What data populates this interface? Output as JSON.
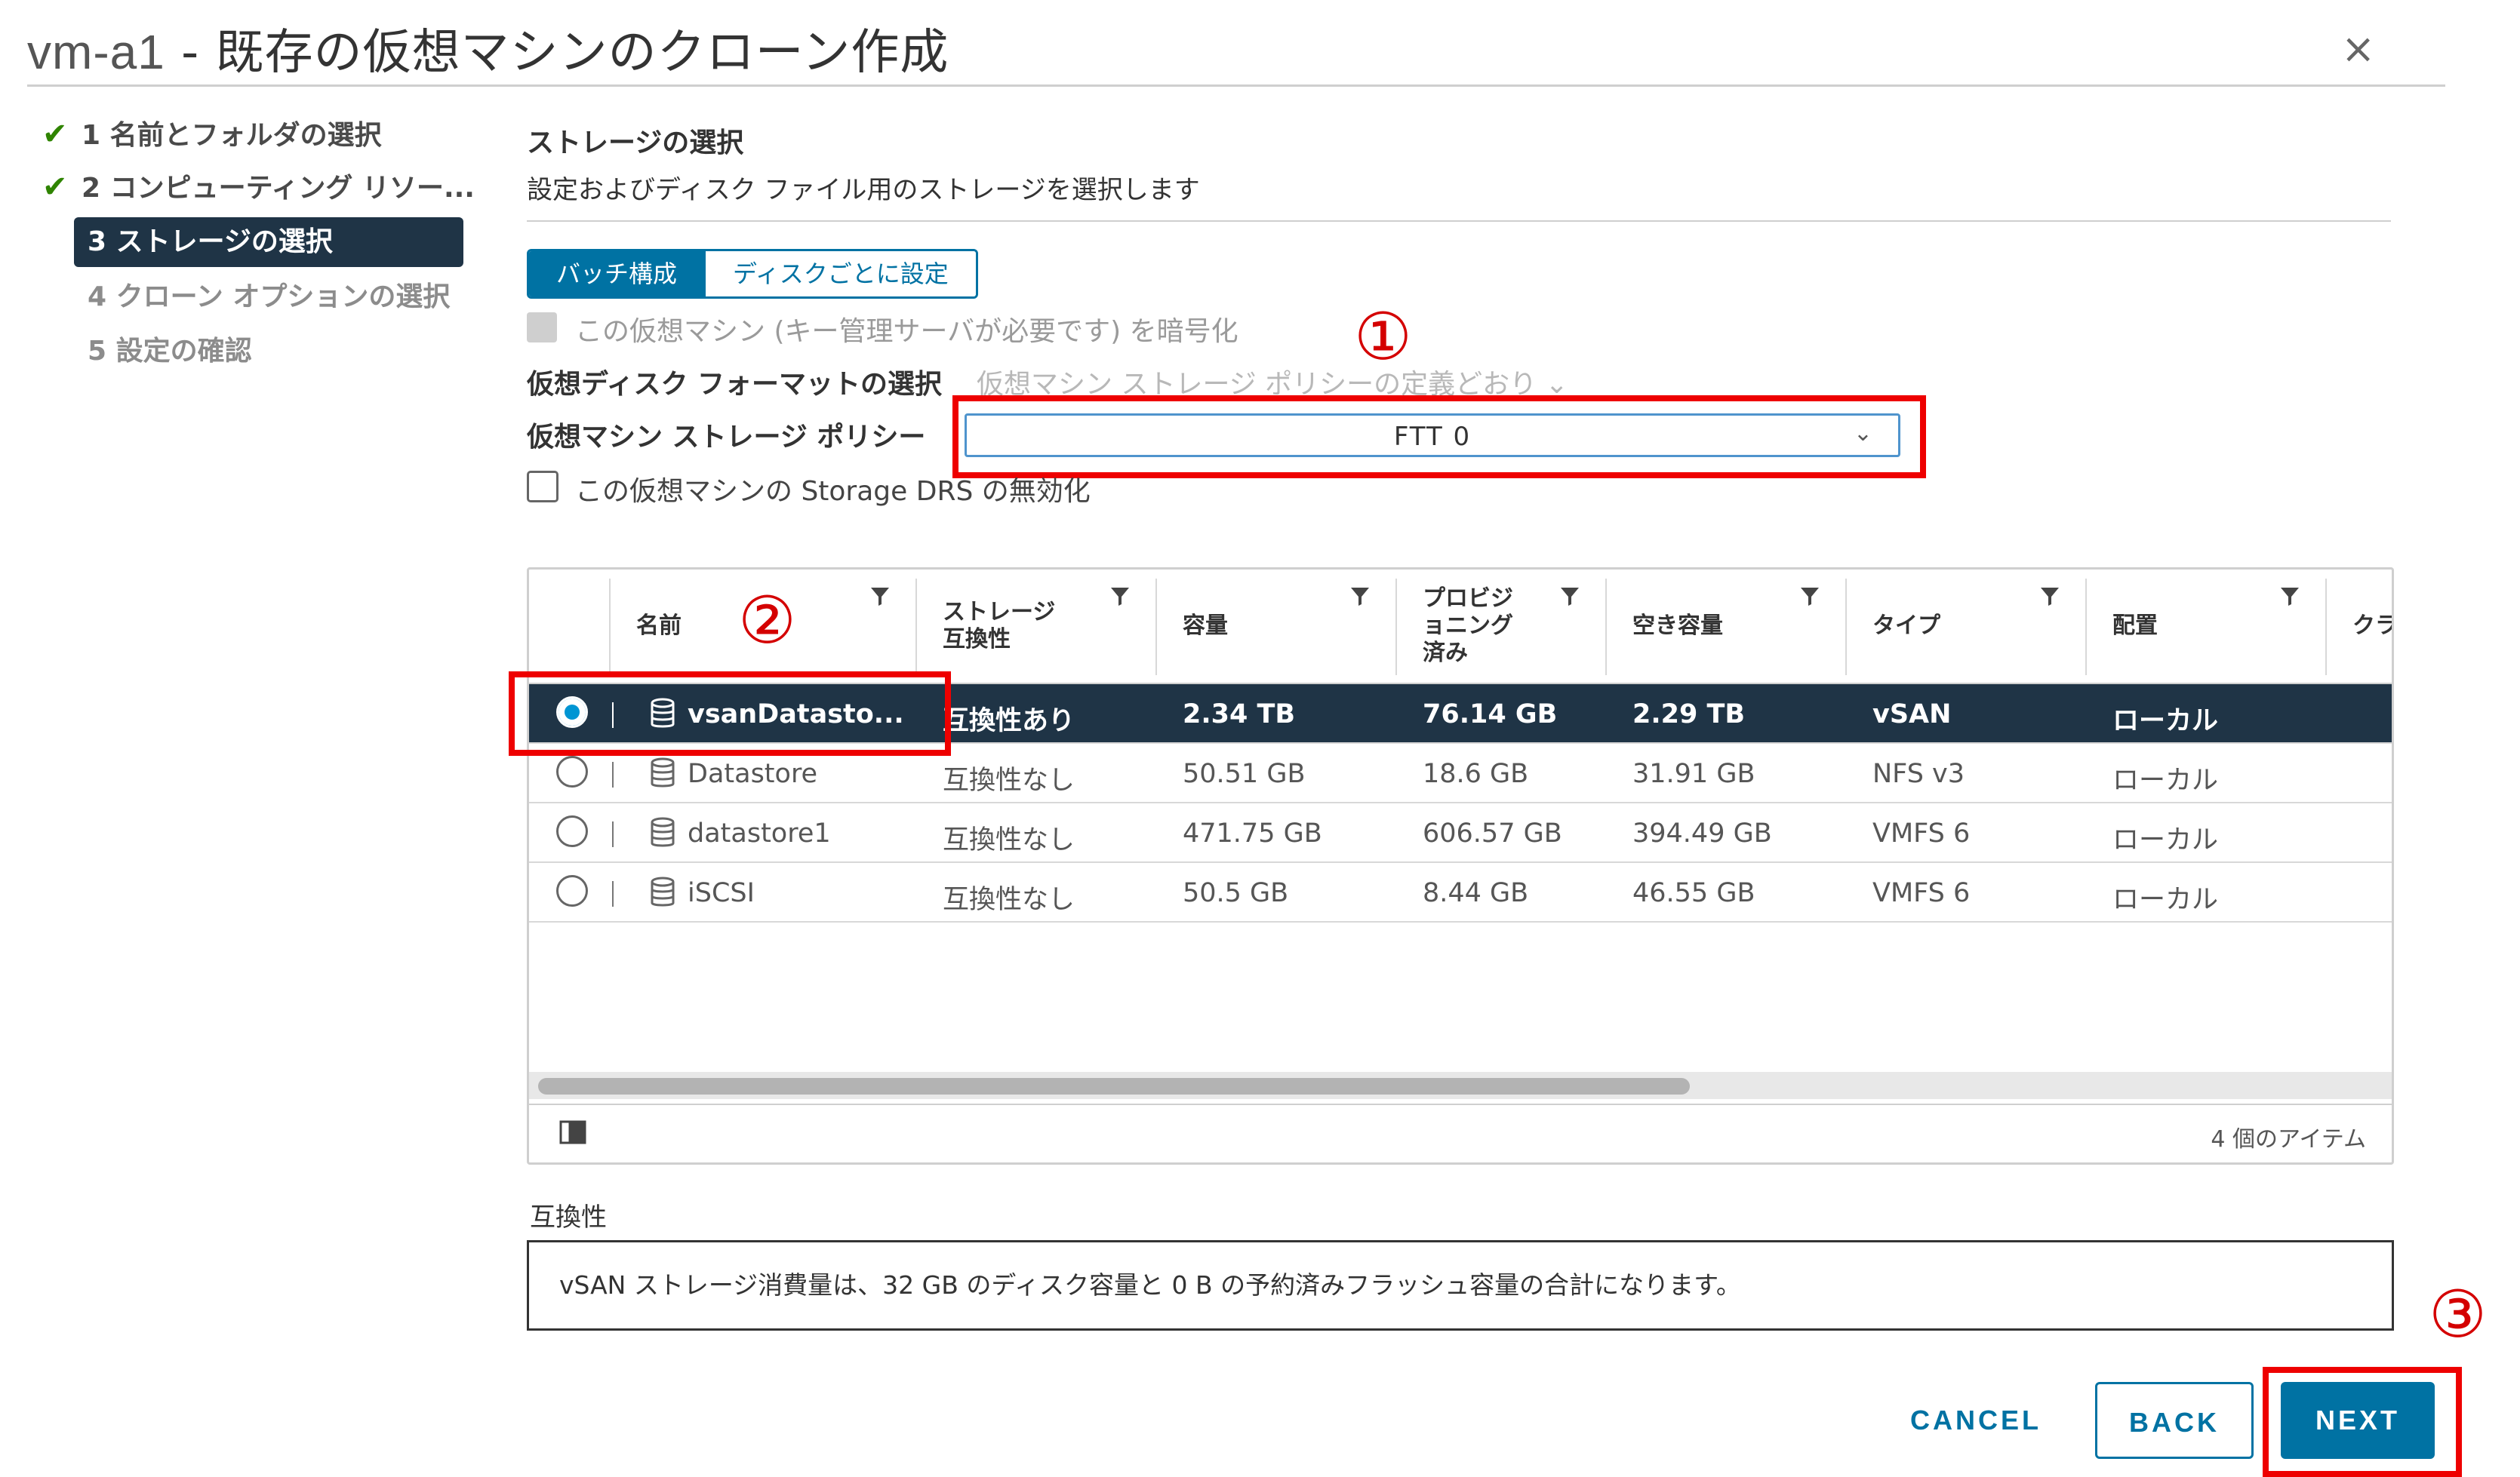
{
  "window": {
    "vm_name": "vm-a1",
    "separator": " - ",
    "title": "既存の仮想マシンのクローン作成",
    "close_icon": "×"
  },
  "steps": [
    {
      "label": "1 名前とフォルダの選択",
      "state": "done"
    },
    {
      "label": "2 コンピューティング リソー...",
      "state": "done"
    },
    {
      "label": "3 ストレージの選択",
      "state": "active"
    },
    {
      "label": "4 クローン オプションの選択",
      "state": "disabled"
    },
    {
      "label": "5 設定の確認",
      "state": "disabled"
    }
  ],
  "section": {
    "title": "ストレージの選択",
    "description": "設定およびディスク ファイル用のストレージを選択します"
  },
  "toggle": {
    "batch": "バッチ構成",
    "per_disk": "ディスクごとに設定"
  },
  "encrypt": {
    "label": "この仮想マシン (キー管理サーバが必要です) を暗号化",
    "checked": false,
    "disabled": true
  },
  "disk_format": {
    "label": "仮想ディスク フォーマットの選択",
    "value": "仮想マシン ストレージ ポリシーの定義どおり"
  },
  "policy": {
    "label": "仮想マシン ストレージ ポリシー",
    "value": "FTT 0"
  },
  "drs": {
    "label": "この仮想マシンの Storage DRS の無効化",
    "checked": false
  },
  "grid": {
    "columns": [
      "名前",
      "ストレージ\n互換性",
      "容量",
      "プロビジ\nョニング\n済み",
      "空き容量",
      "タイプ",
      "配置",
      "クラ"
    ],
    "rows": [
      {
        "name": "vsanDatasto...",
        "compat": "互換性あり",
        "capacity": "2.34 TB",
        "provisioned": "76.14 GB",
        "free": "2.29 TB",
        "type": "vSAN",
        "placement": "ローカル",
        "selected": true
      },
      {
        "name": "Datastore",
        "compat": "互換性なし",
        "capacity": "50.51 GB",
        "provisioned": "18.6 GB",
        "free": "31.91 GB",
        "type": "NFS v3",
        "placement": "ローカル",
        "selected": false
      },
      {
        "name": "datastore1",
        "compat": "互換性なし",
        "capacity": "471.75 GB",
        "provisioned": "606.57 GB",
        "free": "394.49 GB",
        "type": "VMFS 6",
        "placement": "ローカル",
        "selected": false
      },
      {
        "name": "iSCSI",
        "compat": "互換性なし",
        "capacity": "50.5 GB",
        "provisioned": "8.44 GB",
        "free": "46.55 GB",
        "type": "VMFS 6",
        "placement": "ローカル",
        "selected": false
      }
    ],
    "item_count": "4 個のアイテム"
  },
  "compatibility": {
    "label": "互換性",
    "text": "vSAN ストレージ消費量は、32 GB のディスク容量と 0 B の予約済みフラッシュ容量の合計になります。"
  },
  "buttons": {
    "cancel": "CANCEL",
    "back": "BACK",
    "next": "NEXT"
  },
  "annotations": {
    "one": "①",
    "two": "②",
    "three": "③"
  },
  "colors": {
    "accent": "#0072a3",
    "selected_row": "#1f3446",
    "annotation": "#ee0000",
    "check": "#2f8400"
  }
}
